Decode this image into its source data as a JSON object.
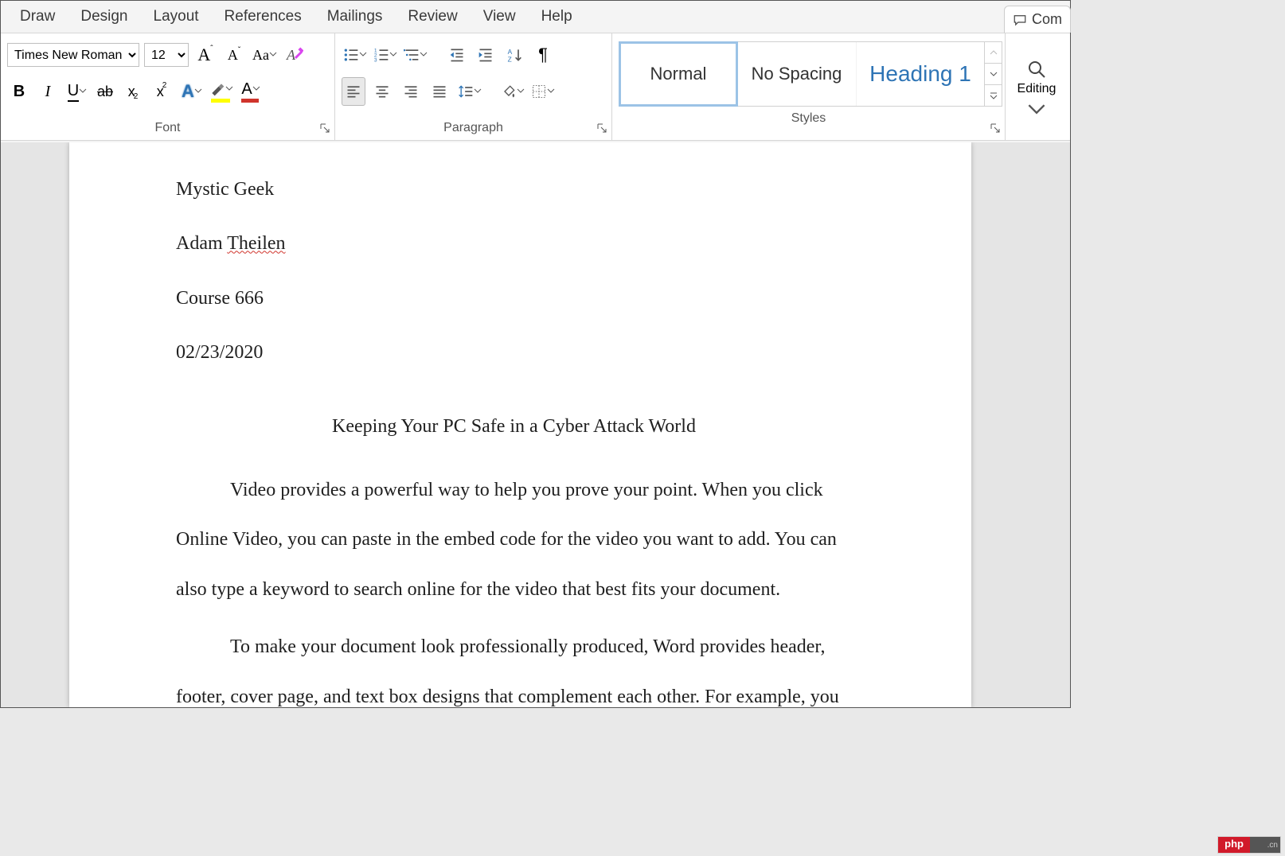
{
  "tabs": [
    "Draw",
    "Design",
    "Layout",
    "References",
    "Mailings",
    "Review",
    "View",
    "Help"
  ],
  "comments_label": "Com",
  "ribbon": {
    "font": {
      "label": "Font",
      "name_value": "Times New Roman",
      "size_value": "12"
    },
    "paragraph": {
      "label": "Paragraph"
    },
    "styles": {
      "label": "Styles",
      "items": [
        {
          "name": "Normal",
          "selected": true
        },
        {
          "name": "No Spacing",
          "selected": false
        },
        {
          "name": "Heading 1",
          "selected": false
        }
      ]
    },
    "editing": {
      "label": "Editing"
    }
  },
  "document": {
    "author": "Mystic Geek",
    "instructor_first": "Adam ",
    "instructor_last": "Theilen",
    "course": "Course 666",
    "date": "02/23/2020",
    "title": "Keeping Your PC Safe in a Cyber Attack World",
    "para1": "Video provides a powerful way to help you prove your point. When you click Online Video, you can paste in the embed code for the video you want to add. You can also type a keyword to search online for the video that best fits your document.",
    "para2": "To make your document look professionally produced, Word provides header, footer, cover page, and text box designs that complement each other. For example, you can add a matching cover page, header, and sidebar. Click Insert and then choose the elements you want from the different galleries."
  },
  "watermark": {
    "left": "php",
    "right": ".cn"
  }
}
